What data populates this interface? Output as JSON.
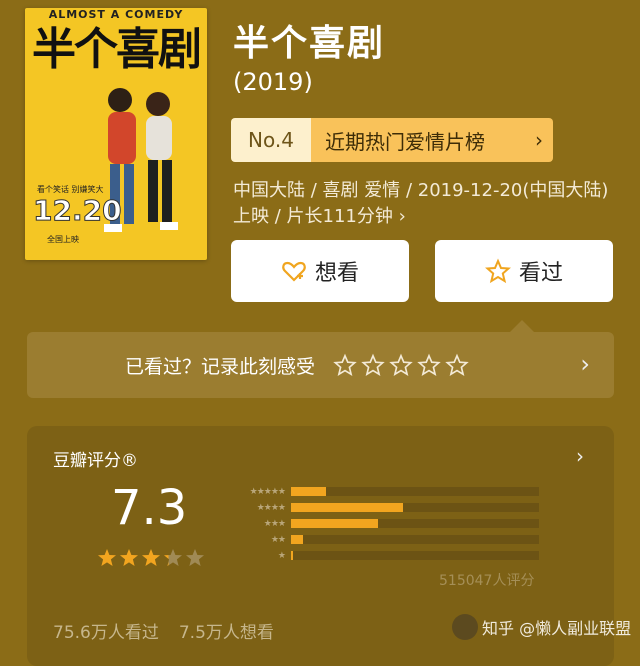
{
  "poster": {
    "english_title": "ALMOST A COMEDY",
    "chinese_title": "半个喜剧",
    "release_date": "12.20",
    "tagline": "看个笑话 别嫌笑大",
    "bottom_text": "全国上映"
  },
  "movie": {
    "title": "半个喜剧",
    "year": "(2019)",
    "rank_no": "No.4",
    "rank_label": "近期热门爱情片榜",
    "info": "中国大陆 / 喜剧 爱情 / 2019-12-20(中国大陆)上映 / 片长111分钟 ›"
  },
  "actions": {
    "want": "想看",
    "seen": "看过"
  },
  "record": {
    "prompt": "已看过？记录此刻感受"
  },
  "rating": {
    "header": "豆瓣评分®",
    "score": "7.3",
    "star_fill": 0.65,
    "distribution": [
      {
        "stars": "★★★★★",
        "fraction": 0.14
      },
      {
        "stars": "★★★★",
        "fraction": 0.45
      },
      {
        "stars": "★★★",
        "fraction": 0.35
      },
      {
        "stars": "★★",
        "fraction": 0.05
      },
      {
        "stars": "★",
        "fraction": 0.01
      }
    ],
    "count_text": "515047人评分"
  },
  "footer": {
    "seen_count": "75.6万人看过",
    "want_count": "7.5万人想看"
  },
  "watermark": "知乎 @懒人副业联盟",
  "colors": {
    "background": "#8b6c17",
    "accent": "#f9c25a",
    "bar_fill": "#f2a51f"
  }
}
